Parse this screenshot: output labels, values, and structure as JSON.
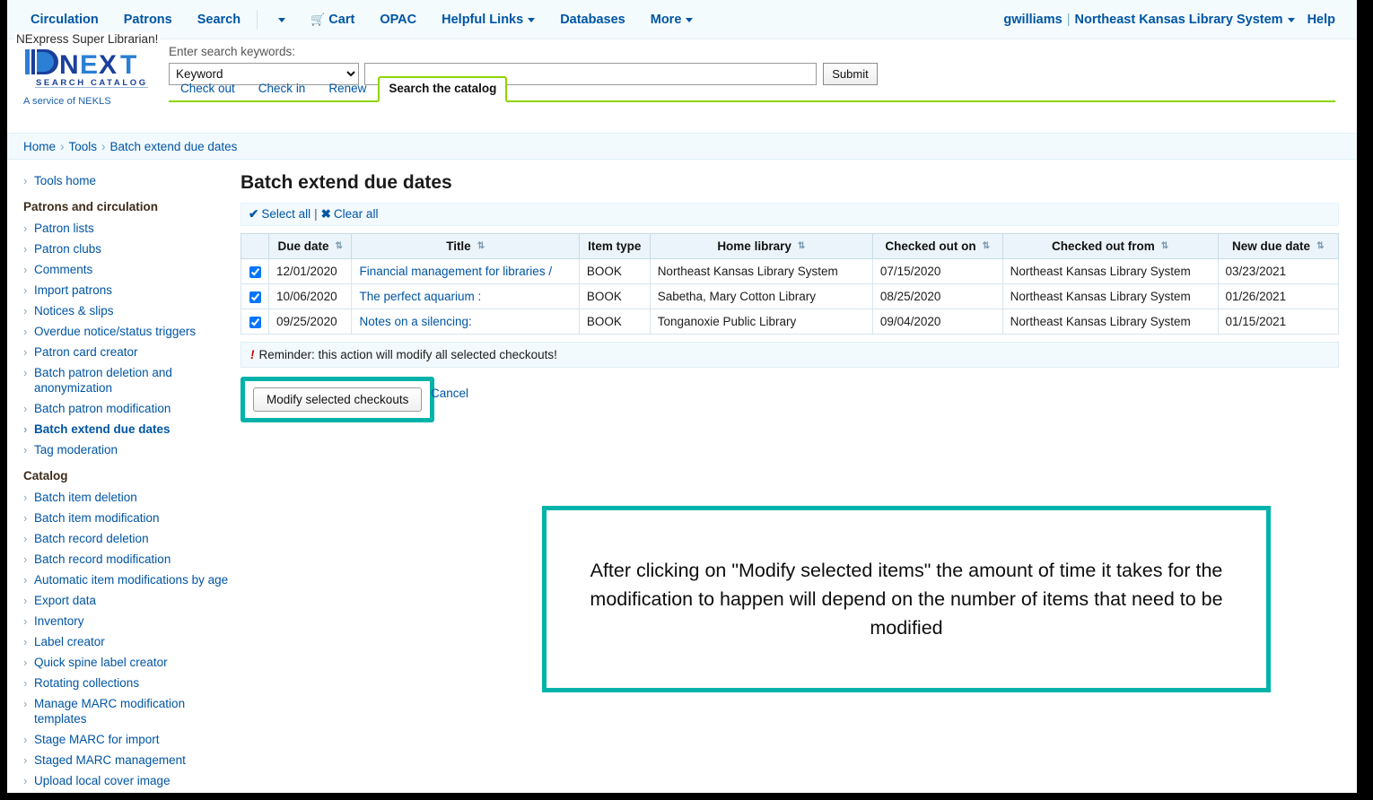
{
  "topnav": {
    "left_items": [
      {
        "label": "Circulation",
        "icon": null,
        "caret": false
      },
      {
        "label": "Patrons",
        "icon": null,
        "caret": false
      },
      {
        "label": "Search",
        "icon": null,
        "caret": false
      },
      {
        "label": "",
        "icon": null,
        "caret": true
      },
      {
        "label": "Cart",
        "icon": "cart-icon",
        "caret": false
      },
      {
        "label": "OPAC",
        "icon": null,
        "caret": false
      },
      {
        "label": "Helpful Links",
        "icon": null,
        "caret": true
      },
      {
        "label": "Databases",
        "icon": null,
        "caret": false
      },
      {
        "label": "More",
        "icon": null,
        "caret": true
      }
    ],
    "user": "gwilliams",
    "library": "Northeast Kansas Library System",
    "help": "Help"
  },
  "superlibrarian": "NExpress Super Librarian!",
  "logo": {
    "wordmark": "NEXT",
    "tagline": "S E A R C H   C A T A L O G",
    "service": "A service of NEKLS",
    "blue_dark": "#1b3f9c",
    "blue_light": "#2b7fd4"
  },
  "search": {
    "label": "Enter search keywords:",
    "index_selected": "Keyword",
    "index_options": [
      "Keyword"
    ],
    "query_value": "",
    "query_placeholder": "",
    "submit_label": "Submit"
  },
  "tabs": [
    {
      "label": "Check out",
      "active": false
    },
    {
      "label": "Check in",
      "active": false
    },
    {
      "label": "Renew",
      "active": false
    },
    {
      "label": "Search the catalog",
      "active": true
    }
  ],
  "breadcrumb": [
    "Home",
    "Tools",
    "Batch extend due dates"
  ],
  "sidebar": {
    "top_link": "Tools home",
    "groups": [
      {
        "heading": "Patrons and circulation",
        "items": [
          {
            "label": "Patron lists",
            "current": false
          },
          {
            "label": "Patron clubs",
            "current": false
          },
          {
            "label": "Comments",
            "current": false
          },
          {
            "label": "Import patrons",
            "current": false
          },
          {
            "label": "Notices & slips",
            "current": false
          },
          {
            "label": "Overdue notice/status triggers",
            "current": false
          },
          {
            "label": "Patron card creator",
            "current": false
          },
          {
            "label": "Batch patron deletion and anonymization",
            "current": false
          },
          {
            "label": "Batch patron modification",
            "current": false
          },
          {
            "label": "Batch extend due dates",
            "current": true
          },
          {
            "label": "Tag moderation",
            "current": false
          }
        ]
      },
      {
        "heading": "Catalog",
        "items": [
          {
            "label": "Batch item deletion",
            "current": false
          },
          {
            "label": "Batch item modification",
            "current": false
          },
          {
            "label": "Batch record deletion",
            "current": false
          },
          {
            "label": "Batch record modification",
            "current": false
          },
          {
            "label": "Automatic item modifications by age",
            "current": false
          },
          {
            "label": "Export data",
            "current": false
          },
          {
            "label": "Inventory",
            "current": false
          },
          {
            "label": "Label creator",
            "current": false
          },
          {
            "label": "Quick spine label creator",
            "current": false
          },
          {
            "label": "Rotating collections",
            "current": false
          },
          {
            "label": "Manage MARC modification templates",
            "current": false
          },
          {
            "label": "Stage MARC for import",
            "current": false
          },
          {
            "label": "Staged MARC management",
            "current": false
          },
          {
            "label": "Upload local cover image",
            "current": false
          }
        ]
      }
    ]
  },
  "main": {
    "title": "Batch extend due dates",
    "select_all": "Select all",
    "clear_all": "Clear all",
    "separator": "|",
    "reminder": "Reminder: this action will modify all selected checkouts!",
    "modify_button": "Modify selected checkouts",
    "cancel_link": "Cancel"
  },
  "table": {
    "columns": [
      {
        "label": "",
        "sortable": false
      },
      {
        "label": "Due date",
        "sortable": true
      },
      {
        "label": "Title",
        "sortable": true
      },
      {
        "label": "Item type",
        "sortable": false
      },
      {
        "label": "Home library",
        "sortable": true
      },
      {
        "label": "Checked out on",
        "sortable": true
      },
      {
        "label": "Checked out from",
        "sortable": true
      },
      {
        "label": "New due date",
        "sortable": true
      }
    ],
    "rows": [
      {
        "checked": true,
        "due_date": "12/01/2020",
        "title": "Financial management for libraries /",
        "item_type": "BOOK",
        "home_library": "Northeast Kansas Library System",
        "checked_out_on": "07/15/2020",
        "checked_out_from": "Northeast Kansas Library System",
        "new_due_date": "03/23/2021"
      },
      {
        "checked": true,
        "due_date": "10/06/2020",
        "title": "The perfect aquarium :",
        "item_type": "BOOK",
        "home_library": "Sabetha, Mary Cotton Library",
        "checked_out_on": "08/25/2020",
        "checked_out_from": "Northeast Kansas Library System",
        "new_due_date": "01/26/2021"
      },
      {
        "checked": true,
        "due_date": "09/25/2020",
        "title": "Notes on a silencing:",
        "item_type": "BOOK",
        "home_library": "Tonganoxie Public Library",
        "checked_out_on": "09/04/2020",
        "checked_out_from": "Northeast Kansas Library System",
        "new_due_date": "01/15/2021"
      }
    ]
  },
  "callout": {
    "text": "After clicking on \"Modify selected items\" the amount of time it takes for the modification to happen will depend on the number of items that need to be modified",
    "border_color": "#00b3aa"
  },
  "colors": {
    "link_blue": "#0055a4",
    "teal_highlight": "#00b3aa",
    "tab_green": "#8fd400",
    "header_bg": "#f4fbfd",
    "table_header_bg": "#eaf4fa"
  }
}
